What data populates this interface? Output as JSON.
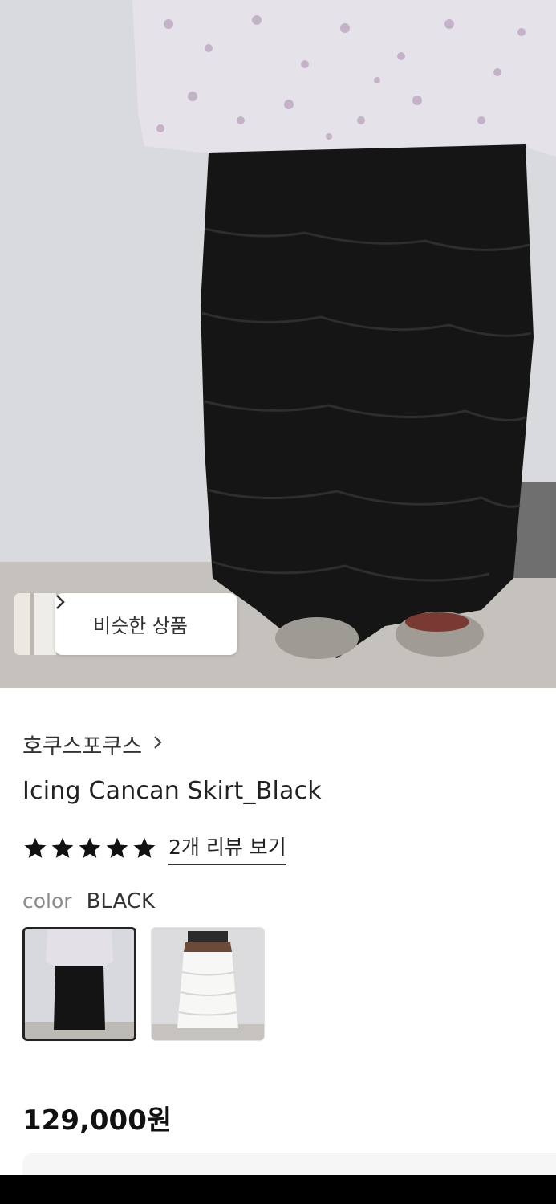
{
  "hero": {
    "similar_button_label": "비슷한 상품",
    "similar_button_icon": "chevron-right-icon"
  },
  "product": {
    "brand": "호쿠스포쿠스",
    "title": "Icing Cancan Skirt_Black",
    "rating": 5,
    "review_link": "2개 리뷰 보기",
    "color_label": "color",
    "color_value": "BLACK",
    "swatches": [
      "black",
      "white"
    ],
    "price": "129,000원"
  },
  "colors": {
    "accent": "#222222",
    "muted": "#8a8a8a",
    "bottom_bar": "#000000"
  }
}
